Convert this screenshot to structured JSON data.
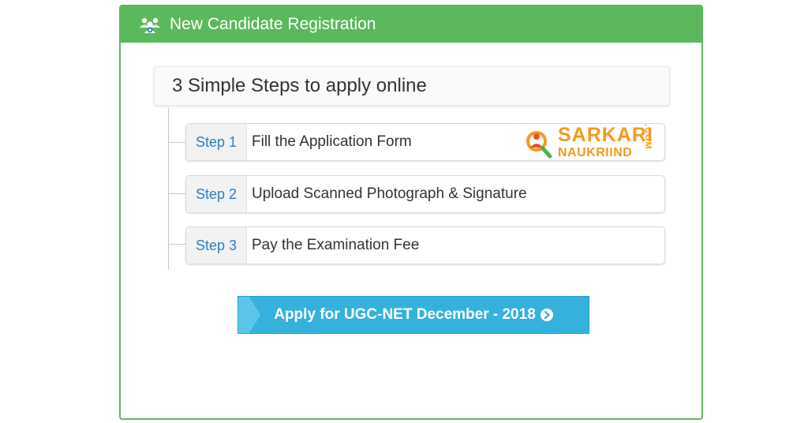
{
  "panel": {
    "title": "New Candidate Registration",
    "header_icon": "users-icon",
    "accent_color": "#5cb85c"
  },
  "steps_title": "3 Simple Steps to apply online",
  "steps": [
    {
      "label": "Step 1",
      "text": "Fill the Application Form"
    },
    {
      "label": "Step 2",
      "text": "Upload Scanned Photograph & Signature"
    },
    {
      "label": "Step 3",
      "text": "Pay the Examination Fee"
    }
  ],
  "apply_button": {
    "label": "Apply for UGC-NET December - 2018",
    "icon": "chevron-circle-right-icon",
    "color": "#35b1de"
  },
  "watermark": {
    "line1": "SARKARI",
    "line2": "NAUKRIIND",
    "suffix": ".COM",
    "color": "#f39a1e"
  }
}
